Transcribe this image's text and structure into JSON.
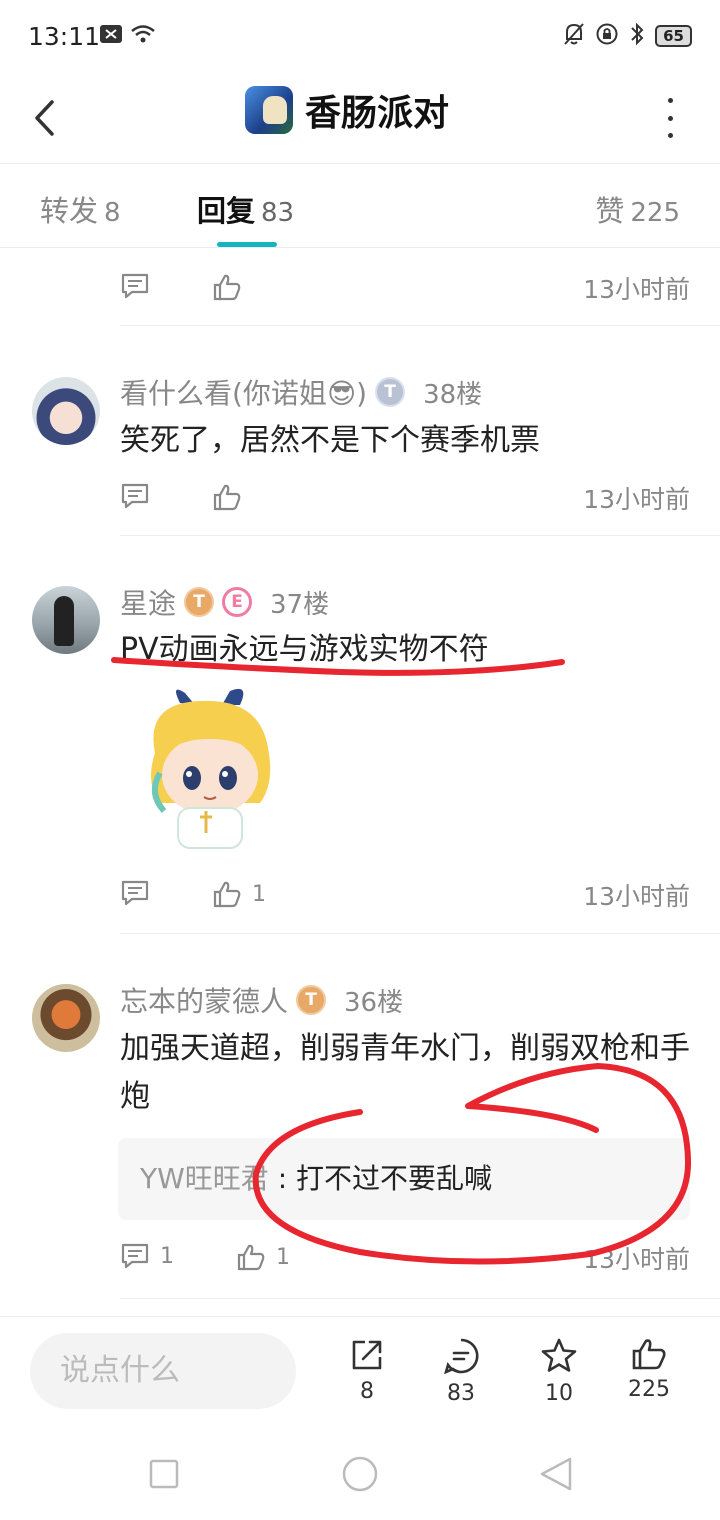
{
  "status_bar": {
    "time": "13:11",
    "battery": "65"
  },
  "header": {
    "title": "香肠派对"
  },
  "tabs": [
    {
      "label": "转发",
      "count": "8"
    },
    {
      "label": "回复",
      "count": "83"
    },
    {
      "label": "赞",
      "count": "225"
    }
  ],
  "top_row": {
    "timestamp": "13小时前"
  },
  "comments": [
    {
      "username": "看什么看(你诺姐",
      "emoji": "😎",
      "username_suffix": ")",
      "badge": "T",
      "floor": "38楼",
      "text": "笑死了，居然不是下个赛季机票",
      "timestamp": "13小时前"
    },
    {
      "username": "星途",
      "badge": "T",
      "badge2": "E",
      "floor": "37楼",
      "text": "PV动画永远与游戏实物不符",
      "like_count": "1",
      "timestamp": "13小时前"
    },
    {
      "username": "忘本的蒙德人",
      "badge": "T",
      "floor": "36楼",
      "text": "加强天道超，削弱青年水门，削弱双枪和手炮",
      "quote_user": "YW旺旺君",
      "quote_sep": " : ",
      "quote_text": "打不过不要乱喊",
      "reply_count": "1",
      "like_count": "1",
      "timestamp": "13小时前"
    }
  ],
  "bottom_bar": {
    "placeholder": "说点什么",
    "share_count": "8",
    "comment_count": "83",
    "star_count": "10",
    "like_count": "225"
  },
  "colors": {
    "accent": "#16b3c0",
    "annotation": "#e8262f"
  }
}
